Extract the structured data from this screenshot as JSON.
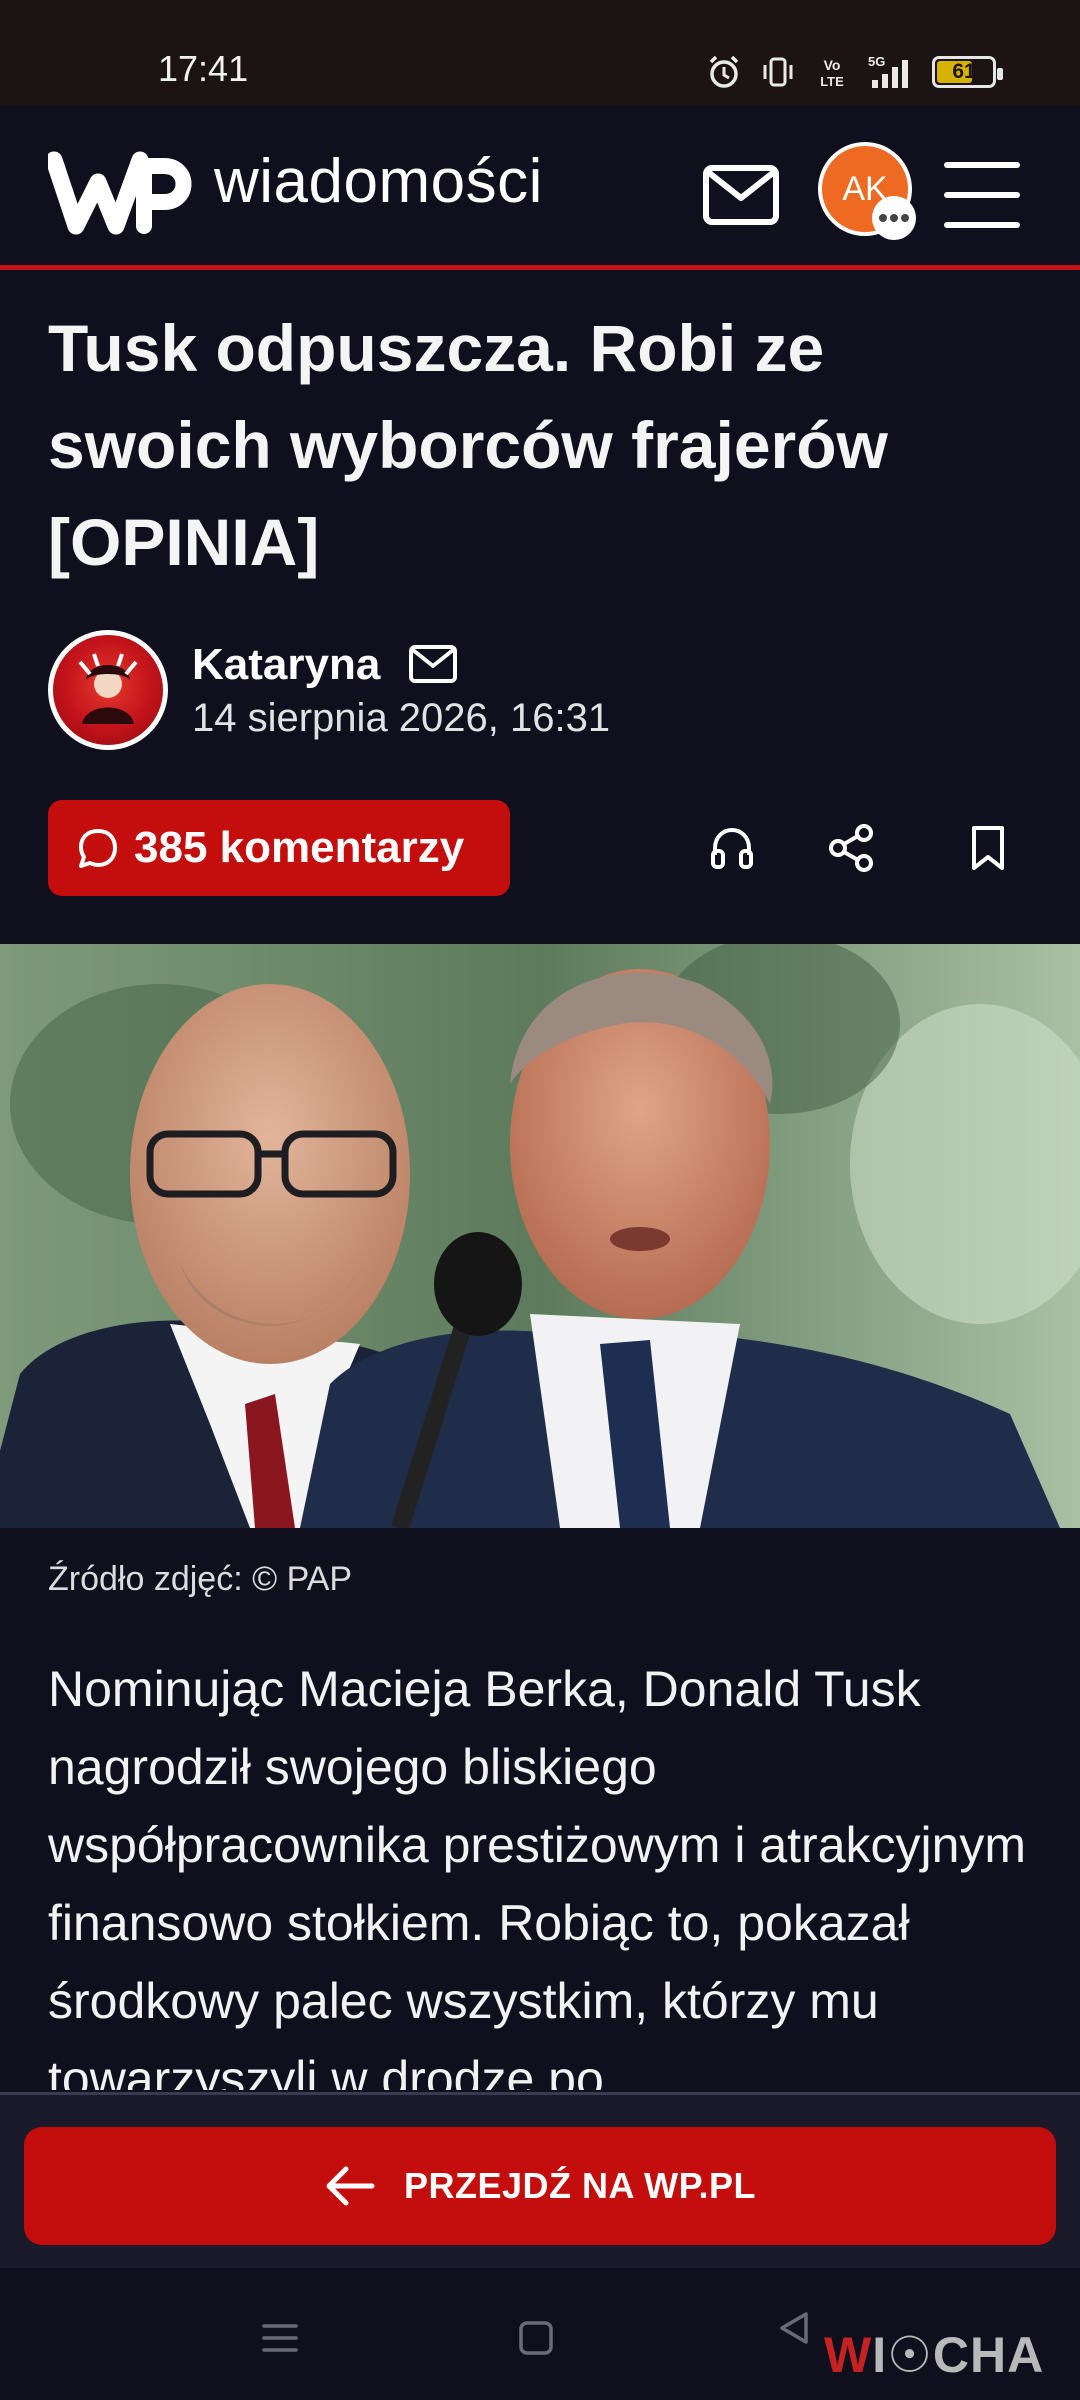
{
  "status_bar": {
    "time": "17:41",
    "icons": [
      "alarm-icon",
      "vibrate-icon",
      "volte-icon",
      "5g-signal-icon",
      "battery-icon"
    ],
    "battery_level": "61"
  },
  "header": {
    "brand": "wiadomości",
    "logo_icon": "wp-logo",
    "avatar_initials": "AK",
    "accent_color": "#c4111a"
  },
  "article": {
    "headline": "Tusk odpuszcza. Robi ze swoich wyborców frajerów [OPINIA]",
    "author": "Kataryna",
    "date": "14 sierpnia 2026, 16:31",
    "comments_label": "385 komentarzy",
    "photo_caption": "Źródło zdjęć: © PAP",
    "body": "Nominując Macieja Berka, Donald Tusk nagrodził swojego bliskiego współpracownika prestiżowym i atrakcyjnym finansowo stołkiem. Robiąc to, pokazał środkowy palec wszystkim, którzy mu towarzyszyli w drodze po"
  },
  "actions": {
    "listen_icon": "headphones-icon",
    "share_icon": "share-icon",
    "bookmark_icon": "bookmark-icon"
  },
  "sticky": {
    "goto_label": "PRZEJDŹ NA WP.PL"
  },
  "watermark": {
    "first": "W",
    "rest": "I☉CHA"
  }
}
